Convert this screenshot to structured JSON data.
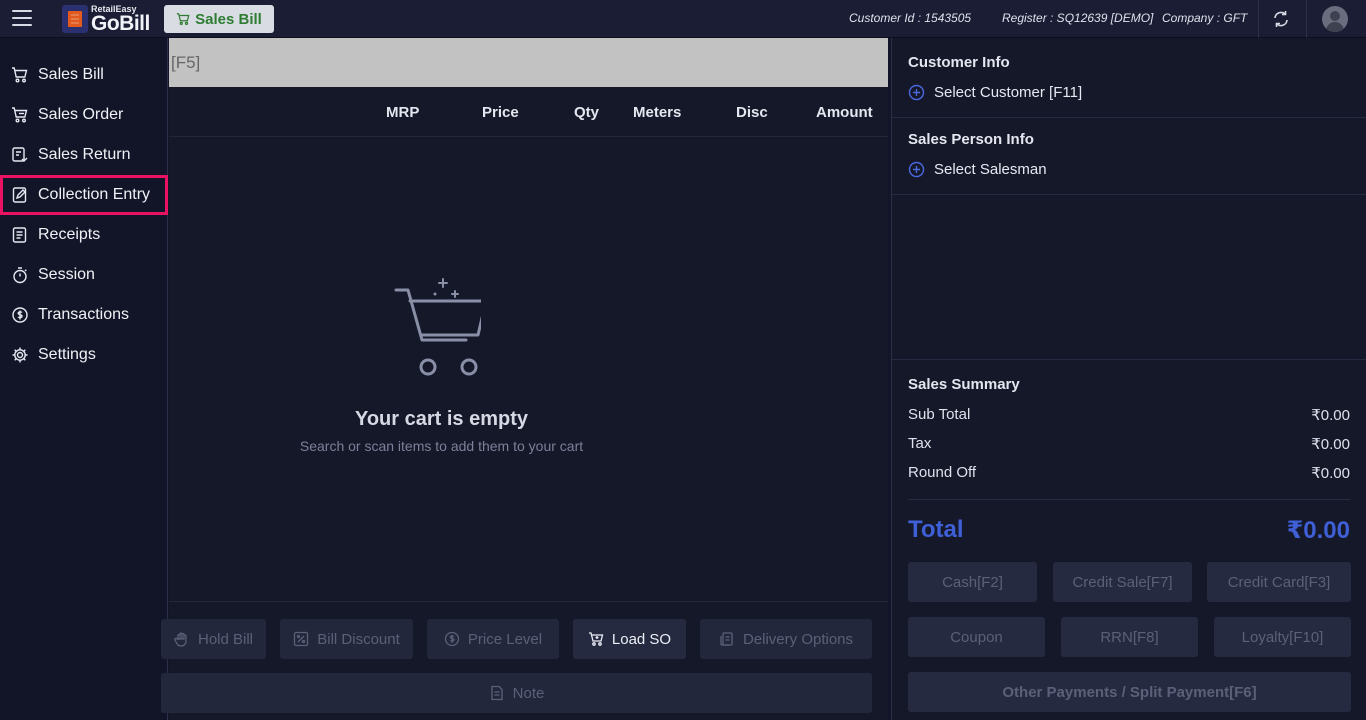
{
  "header": {
    "logo_small": "RetailEasy",
    "logo_big": "GoBill",
    "active_tab": "Sales Bill",
    "customer_id": "Customer Id : 1543505",
    "register": "Register : SQ12639 [DEMO]",
    "company": "Company : GFT"
  },
  "sidebar": {
    "items": [
      {
        "label": "Sales Bill",
        "icon": "cart-icon"
      },
      {
        "label": "Sales Order",
        "icon": "cart-order-icon"
      },
      {
        "label": "Sales Return",
        "icon": "return-icon"
      },
      {
        "label": "Collection Entry",
        "icon": "edit-doc-icon"
      },
      {
        "label": "Receipts",
        "icon": "receipt-icon"
      },
      {
        "label": "Session",
        "icon": "stopwatch-icon"
      },
      {
        "label": "Transactions",
        "icon": "dollar-cycle-icon"
      },
      {
        "label": "Settings",
        "icon": "gear-icon"
      }
    ]
  },
  "main": {
    "search_hint": "[F5]",
    "columns": [
      "MRP",
      "Price",
      "Qty",
      "Meters",
      "Disc",
      "Amount"
    ],
    "empty_title": "Your cart is empty",
    "empty_subtitle": "Search or scan items to add them to your cart",
    "actions": {
      "hold_bill": "Hold Bill",
      "bill_discount": "Bill Discount",
      "price_level": "Price Level",
      "load_so": "Load SO",
      "delivery_options": "Delivery Options",
      "note": "Note"
    }
  },
  "right": {
    "customer_title": "Customer Info",
    "select_customer": "Select Customer [F11]",
    "sales_person_title": "Sales Person Info",
    "select_salesman": "Select Salesman",
    "summary_title": "Sales Summary",
    "summary": [
      {
        "label": "Sub Total",
        "value": "₹0.00"
      },
      {
        "label": "Tax",
        "value": "₹0.00"
      },
      {
        "label": "Round Off",
        "value": "₹0.00"
      }
    ],
    "total_label": "Total",
    "total_value": "₹0.00",
    "payments": {
      "cash": "Cash[F2]",
      "credit_sale": "Credit Sale[F7]",
      "credit_card": "Credit Card[F3]",
      "coupon": "Coupon",
      "rrn": "RRN[F8]",
      "loyalty": "Loyalty[F10]",
      "other": "Other Payments / Split Payment[F6]"
    }
  },
  "colors": {
    "accent": "#3f5fd6",
    "highlight": "#ea1262",
    "chip_text": "#2e7d32"
  }
}
